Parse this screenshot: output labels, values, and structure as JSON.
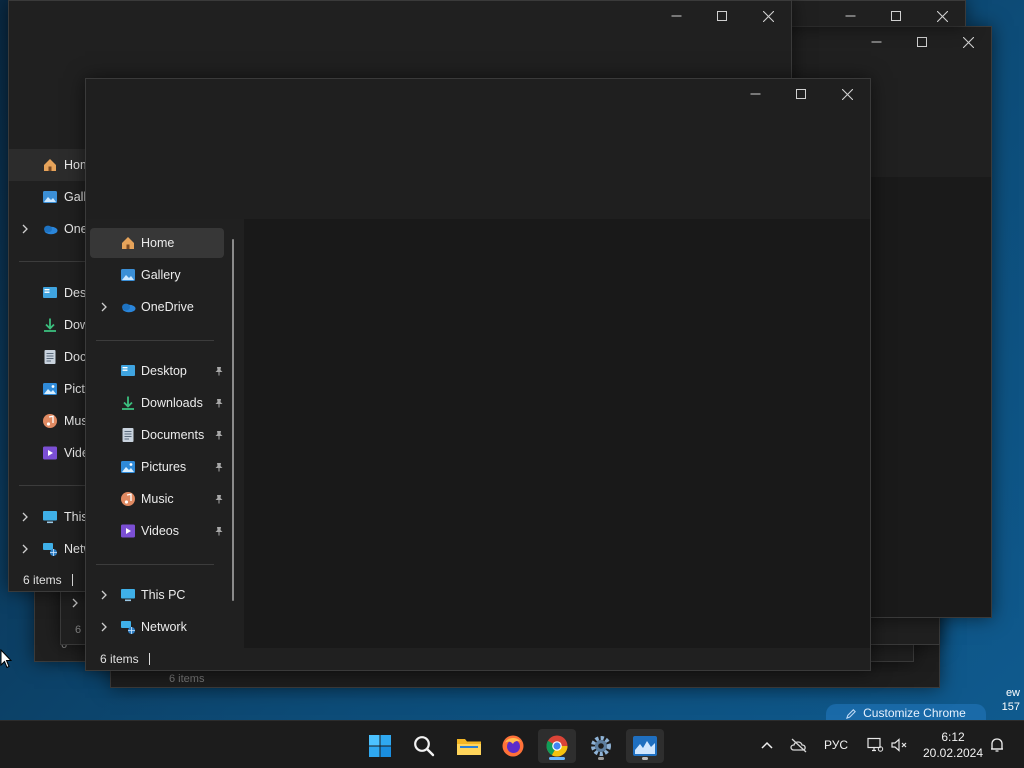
{
  "desktop": {
    "side_text_top": "ew",
    "side_text_bottom": "157",
    "chrome_chip_label": "Customize Chrome"
  },
  "back_window": {
    "status_items": "6 items",
    "nav_items": [
      {
        "label": "Home",
        "icon": "home-icon"
      },
      {
        "label": "Gallery",
        "icon": "gallery-icon"
      },
      {
        "label": "OneDrive",
        "icon": "onedrive-icon"
      },
      {
        "label": "Desktop",
        "icon": "desktop-icon"
      },
      {
        "label": "Downloads",
        "icon": "downloads-icon"
      },
      {
        "label": "Documents",
        "icon": "documents-icon"
      },
      {
        "label": "Pictures",
        "icon": "pictures-icon"
      },
      {
        "label": "Music",
        "icon": "music-icon"
      },
      {
        "label": "Videos",
        "icon": "videos-icon"
      },
      {
        "label": "This PC",
        "icon": "this-pc-icon"
      },
      {
        "label": "Network",
        "icon": "network-icon"
      }
    ]
  },
  "stacked_status": [
    "6",
    "6",
    "6 items",
    "6 items"
  ],
  "front_window": {
    "status_items": "6 items",
    "nav": {
      "home": "Home",
      "gallery": "Gallery",
      "onedrive": "OneDrive",
      "desktop": "Desktop",
      "downloads": "Downloads",
      "documents": "Documents",
      "pictures": "Pictures",
      "music": "Music",
      "videos": "Videos",
      "this_pc": "This PC",
      "network": "Network"
    }
  },
  "taskbar": {
    "apps": [
      "start-icon",
      "search-icon",
      "file-explorer-icon",
      "firefox-icon",
      "chrome-icon",
      "settings-icon",
      "task-manager-icon"
    ],
    "language": "РУС",
    "time": "6:12",
    "date": "20.02.2024"
  },
  "colors": {
    "window_bg": "#202020",
    "content_bg": "#191919",
    "taskbar_bg": "#1c1c1c",
    "accent": "#6ab7ff"
  }
}
